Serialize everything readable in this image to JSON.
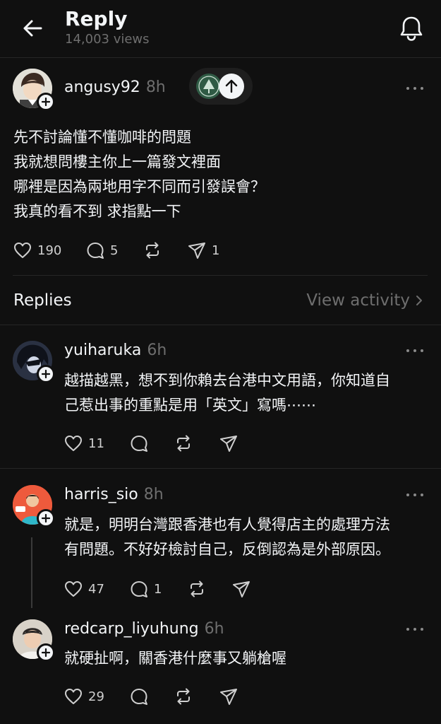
{
  "header": {
    "title": "Reply",
    "views": "14,003 views"
  },
  "main_post": {
    "username": "angusy92",
    "time": "8h",
    "text": "先不討論懂不懂咖啡的問題\n我就想問樓主你上一篇發文裡面\n哪裡是因為兩地用字不同而引發誤會？\n我真的看不到 求指點一下",
    "likes": "190",
    "comments": "5",
    "shares": "1"
  },
  "replies_bar": {
    "label": "Replies",
    "view_activity": "View activity"
  },
  "replies": [
    {
      "username": "yuiharuka",
      "time": "6h",
      "text": "越描越黑，想不到你賴去台港中文用語，你知道自\n己惹出事的重點是用「英文」寫嗎⋯⋯",
      "likes": "11",
      "comments": "",
      "shares": ""
    },
    {
      "username": "harris_sio",
      "time": "8h",
      "text": "就是，明明台灣跟香港也有人覺得店主的處理方法\n有問題。不好好檢討自己，反倒認為是外部原因。",
      "likes": "47",
      "comments": "1",
      "shares": ""
    },
    {
      "username": "redcarp_liyuhung",
      "time": "6h",
      "text": "就硬扯啊，關香港什麼事又躺槍喔",
      "likes": "29",
      "comments": "",
      "shares": ""
    }
  ],
  "icons": {
    "back": "arrow-left-icon",
    "bell": "bell-icon",
    "heart": "heart-icon",
    "comment": "comment-icon",
    "repost": "repost-icon",
    "share": "send-icon",
    "more": "more-dots-icon",
    "chevron": "chevron-right-icon"
  },
  "colors": {
    "background": "#101010",
    "text": "#f3f5f7",
    "muted": "#6e6e6e",
    "divider": "#262626"
  }
}
